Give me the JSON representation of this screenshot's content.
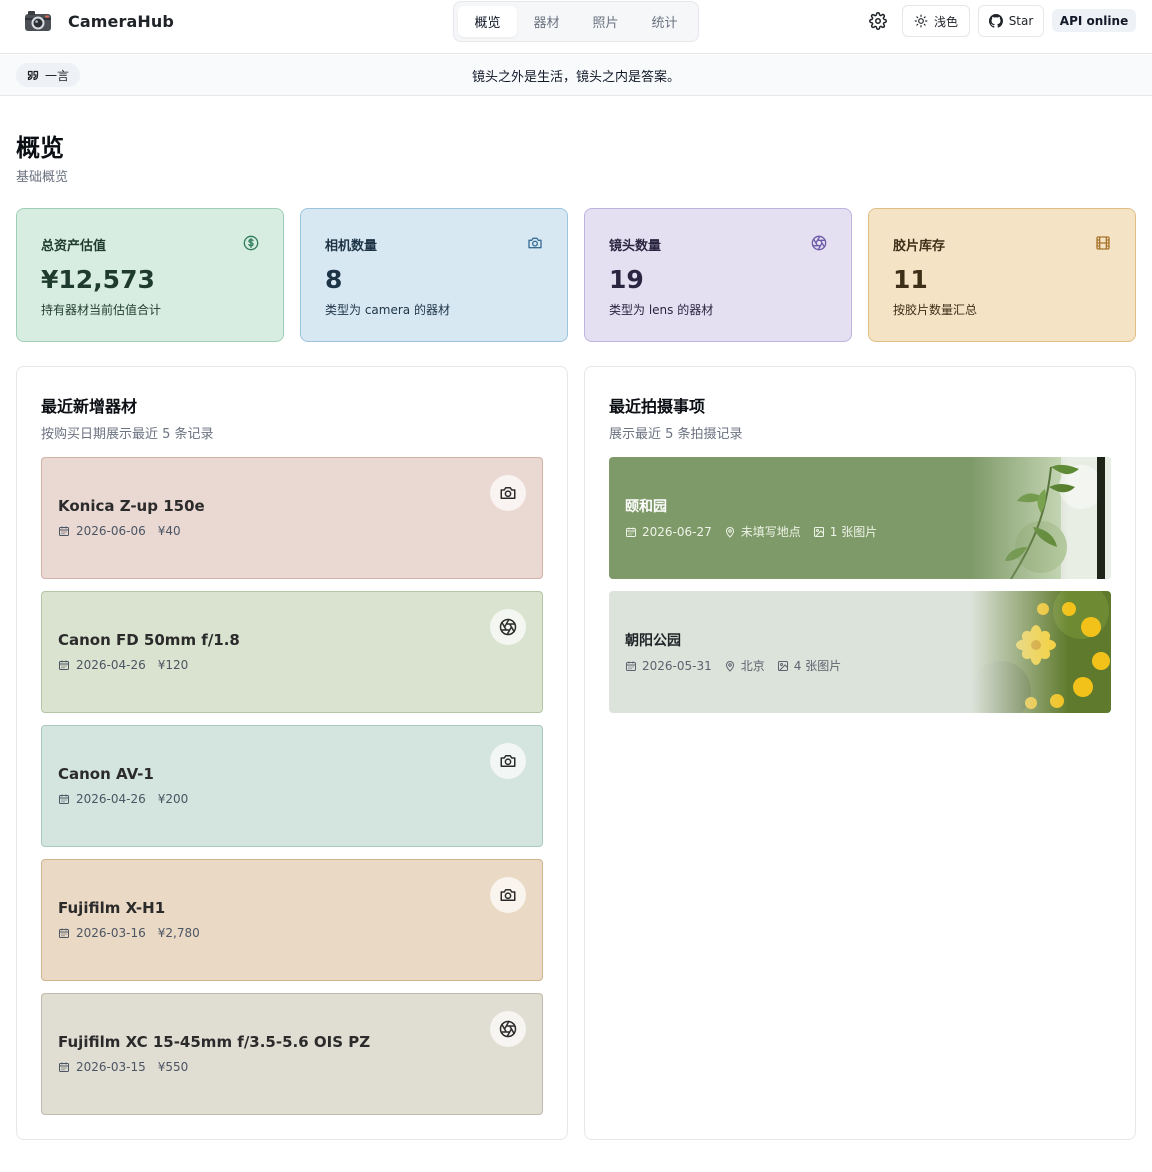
{
  "app": {
    "name": "CameraHub"
  },
  "nav": {
    "tabs": [
      {
        "label": "概览",
        "active": true
      },
      {
        "label": "器材",
        "active": false
      },
      {
        "label": "照片",
        "active": false
      },
      {
        "label": "统计",
        "active": false
      }
    ]
  },
  "toolbar": {
    "settings_icon": "gear-icon",
    "theme_label": "浅色",
    "theme_icon": "sun-icon",
    "star_label": "Star",
    "star_icon": "github-icon",
    "api_status": "API online"
  },
  "quote": {
    "chip_label": "一言",
    "chip_icon": "quote-icon",
    "text": "镜头之外是生活，镜头之内是答案。"
  },
  "page": {
    "title": "概览",
    "subtitle": "基础概览"
  },
  "stats": [
    {
      "label": "总资产估值",
      "value": "¥12,573",
      "desc": "持有器材当前估值合计",
      "icon": "dollar-icon",
      "bg": "#d8ede2",
      "border": "#9fd0b7",
      "fg": "#1f3b2f",
      "ico_color": "#2f7d5b"
    },
    {
      "label": "相机数量",
      "value": "8",
      "desc": "类型为 camera 的器材",
      "icon": "camera-icon",
      "bg": "#d7e8f3",
      "border": "#9cc4de",
      "fg": "#1d3446",
      "ico_color": "#3a6e94"
    },
    {
      "label": "镜头数量",
      "value": "19",
      "desc": "类型为 lens 的器材",
      "icon": "aperture-icon",
      "bg": "#e4dff1",
      "border": "#bfb3df",
      "fg": "#2a2540",
      "ico_color": "#6c5aa8"
    },
    {
      "label": "胶片库存",
      "value": "11",
      "desc": "按胶片数量汇总",
      "icon": "film-icon",
      "bg": "#f4e3c5",
      "border": "#e0be85",
      "fg": "#3d2f18",
      "ico_color": "#a6742a"
    }
  ],
  "recent_gear": {
    "title": "最近新增器材",
    "subtitle": "按购买日期展示最近 5 条记录",
    "items": [
      {
        "name": "Konica Z-up 150e",
        "date": "2026-06-06",
        "price": "¥40",
        "type_icon": "camera-icon",
        "bg": "#ead8d2",
        "border": "#d2b1a7"
      },
      {
        "name": "Canon FD 50mm f/1.8",
        "date": "2026-04-26",
        "price": "¥120",
        "type_icon": "aperture-icon",
        "bg": "#d9e3cf",
        "border": "#b4c6a4"
      },
      {
        "name": "Canon AV-1",
        "date": "2026-04-26",
        "price": "¥200",
        "type_icon": "camera-icon",
        "bg": "#d4e5df",
        "border": "#a9c9bd"
      },
      {
        "name": "Fujifilm X-H1",
        "date": "2026-03-16",
        "price": "¥2,780",
        "type_icon": "camera-icon",
        "bg": "#ead9c4",
        "border": "#cfb48f"
      },
      {
        "name": "Fujifilm XC 15-45mm f/3.5-5.6 OIS PZ",
        "date": "2026-03-15",
        "price": "¥550",
        "type_icon": "aperture-icon",
        "bg": "#e0ddd2",
        "border": "#bfbaa9"
      }
    ]
  },
  "recent_shoots": {
    "title": "最近拍摄事项",
    "subtitle": "展示最近 5 条拍摄记录",
    "items": [
      {
        "name": "颐和园",
        "date": "2026-06-27",
        "location": "未填写地点",
        "photos": "1 张图片",
        "bg": "#7f9a69",
        "fg": "#ffffff",
        "meta_color": "#eef3e8",
        "photo_icon": "leaf-photo"
      },
      {
        "name": "朝阳公园",
        "date": "2026-05-31",
        "location": "北京",
        "photos": "4 张图片",
        "bg": "#dce3da",
        "fg": "#1f2328",
        "meta_color": "#5b6470",
        "photo_icon": "flower-photo"
      }
    ]
  }
}
